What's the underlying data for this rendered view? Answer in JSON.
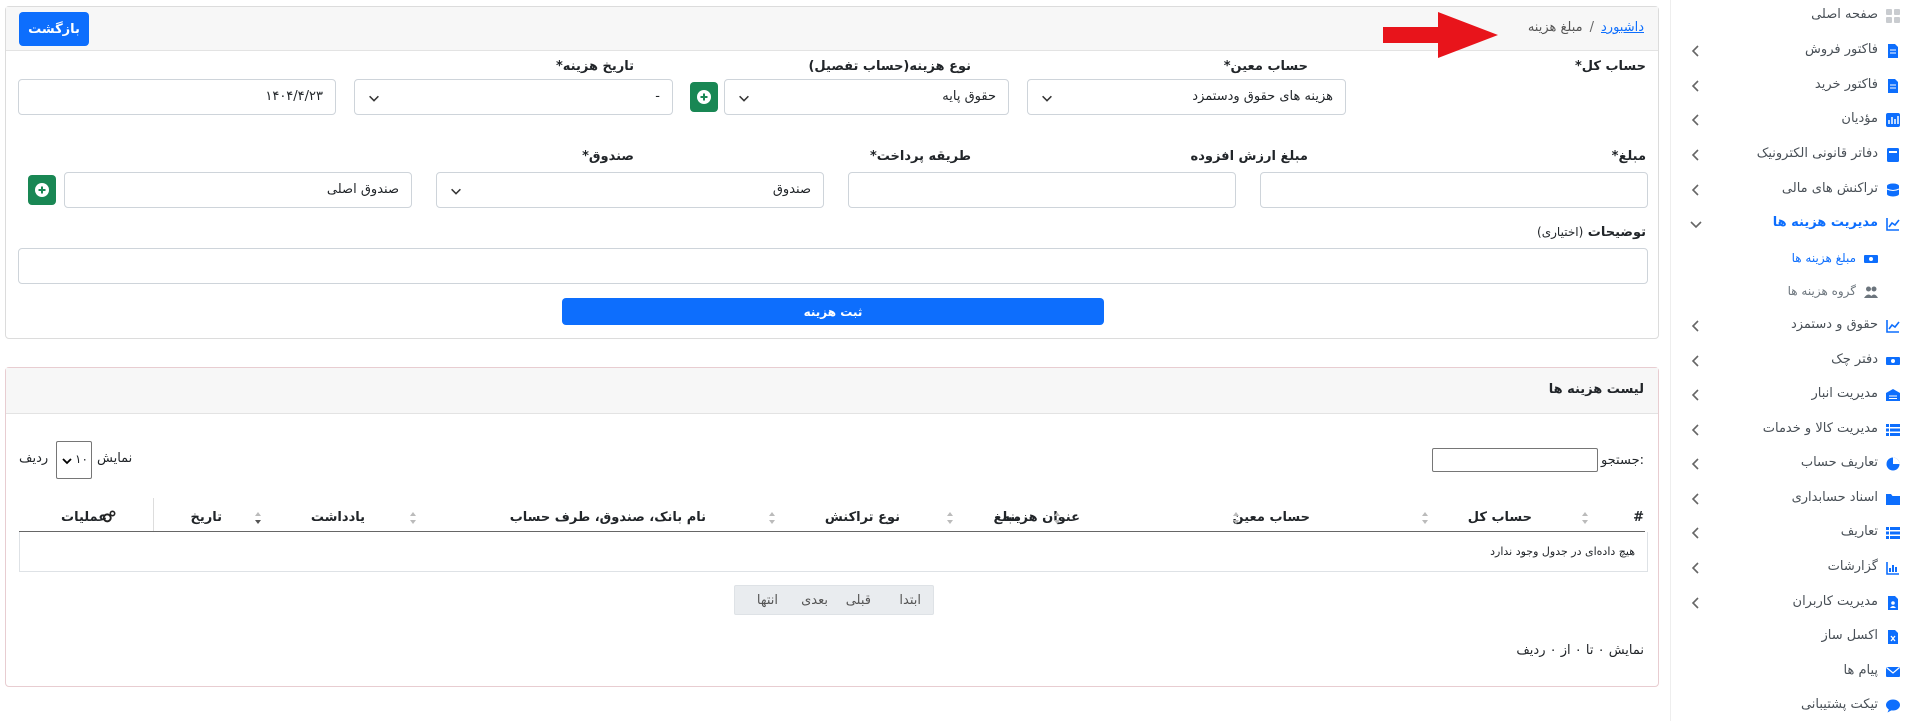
{
  "breadcrumb": {
    "home": "داشبورد",
    "separator": "/",
    "current": "مبلغ هزینه"
  },
  "header": {
    "back_label": "بازگشت"
  },
  "form": {
    "account_total": {
      "label": "حساب کل*",
      "value": "هزینه های حقوق ودستمزد"
    },
    "account_moein": {
      "label": "حساب معین*",
      "value": "حقوق پایه"
    },
    "expense_type": {
      "label": "نوع هزینه(حساب تفصیل)",
      "value": "-"
    },
    "expense_date": {
      "label": "تاریخ هزینه*",
      "value": "۱۴۰۴/۴/۲۳"
    },
    "amount": {
      "label": "مبلغ*",
      "value": ""
    },
    "vat": {
      "label": "مبلغ ارزش افزوده",
      "value": ""
    },
    "payment_method": {
      "label": "طریقه پرداخت*",
      "value": "صندوق"
    },
    "fund": {
      "label": "صندوق*",
      "value": "صندوق اصلی"
    },
    "description": {
      "label": "توضیحات",
      "optional": "(اختیاری)",
      "value": ""
    },
    "submit_label": "ثبت هزینه"
  },
  "list": {
    "title": "لیست هزینه ها",
    "search_label": "جستجو:",
    "length": {
      "before": "نمایش",
      "value": "۱۰",
      "after": "ردیف"
    },
    "columns": [
      "#",
      "حساب کل",
      "حساب معین",
      "عنوان هزینه",
      "مبلغ",
      "نوع تراکنش",
      "نام بانک، صندوق، طرف حساب",
      "یادداشت",
      "تاریخ",
      "عملیات"
    ],
    "empty_text": "هیچ داده‌ای در جدول وجود ندارد",
    "pagination": {
      "first": "ابتدا",
      "prev": "قبلی",
      "next": "بعدی",
      "last": "انتها"
    },
    "info": "نمایش ۰ تا ۰ از ۰ ردیف"
  },
  "sidebar": {
    "items": [
      {
        "label": "صفحه اصلی",
        "icon": "grid-icon"
      },
      {
        "label": "فاکتور فروش",
        "icon": "invoice-icon"
      },
      {
        "label": "فاکتور خرید",
        "icon": "invoice-icon"
      },
      {
        "label": "مؤدیان",
        "icon": "chart-icon"
      },
      {
        "label": "دفاتر قانونی الکترونیک",
        "icon": "book-icon"
      },
      {
        "label": "تراکنش های مالی",
        "icon": "coins-icon"
      },
      {
        "label": "مدیریت هزینه ها",
        "icon": "line-chart-icon"
      },
      {
        "label": "مبلغ هزینه ها",
        "icon": "money-icon"
      },
      {
        "label": "گروه هزینه ها",
        "icon": "users-icon"
      },
      {
        "label": "حقوق و دستمزد",
        "icon": "line-chart-icon"
      },
      {
        "label": "دفتر چک",
        "icon": "money-icon"
      },
      {
        "label": "مدیریت انبار",
        "icon": "warehouse-icon"
      },
      {
        "label": "مدیریت کالا و خدمات",
        "icon": "list-icon"
      },
      {
        "label": "تعاریف حساب",
        "icon": "pie-icon"
      },
      {
        "label": "اسناد حسابداری",
        "icon": "folder-icon"
      },
      {
        "label": "تعاریف",
        "icon": "list-icon"
      },
      {
        "label": "گزارشات",
        "icon": "chart-icon"
      },
      {
        "label": "مدیریت کاربران",
        "icon": "user-doc-icon"
      },
      {
        "label": "اکسل ساز",
        "icon": "excel-icon"
      },
      {
        "label": "پیام ها",
        "icon": "envelope-icon"
      },
      {
        "label": "تیکت پشتیبانی",
        "icon": "chat-icon"
      }
    ]
  },
  "colors": {
    "primary": "#0d6efd",
    "success": "#198754",
    "arrow": "#e8141b"
  }
}
